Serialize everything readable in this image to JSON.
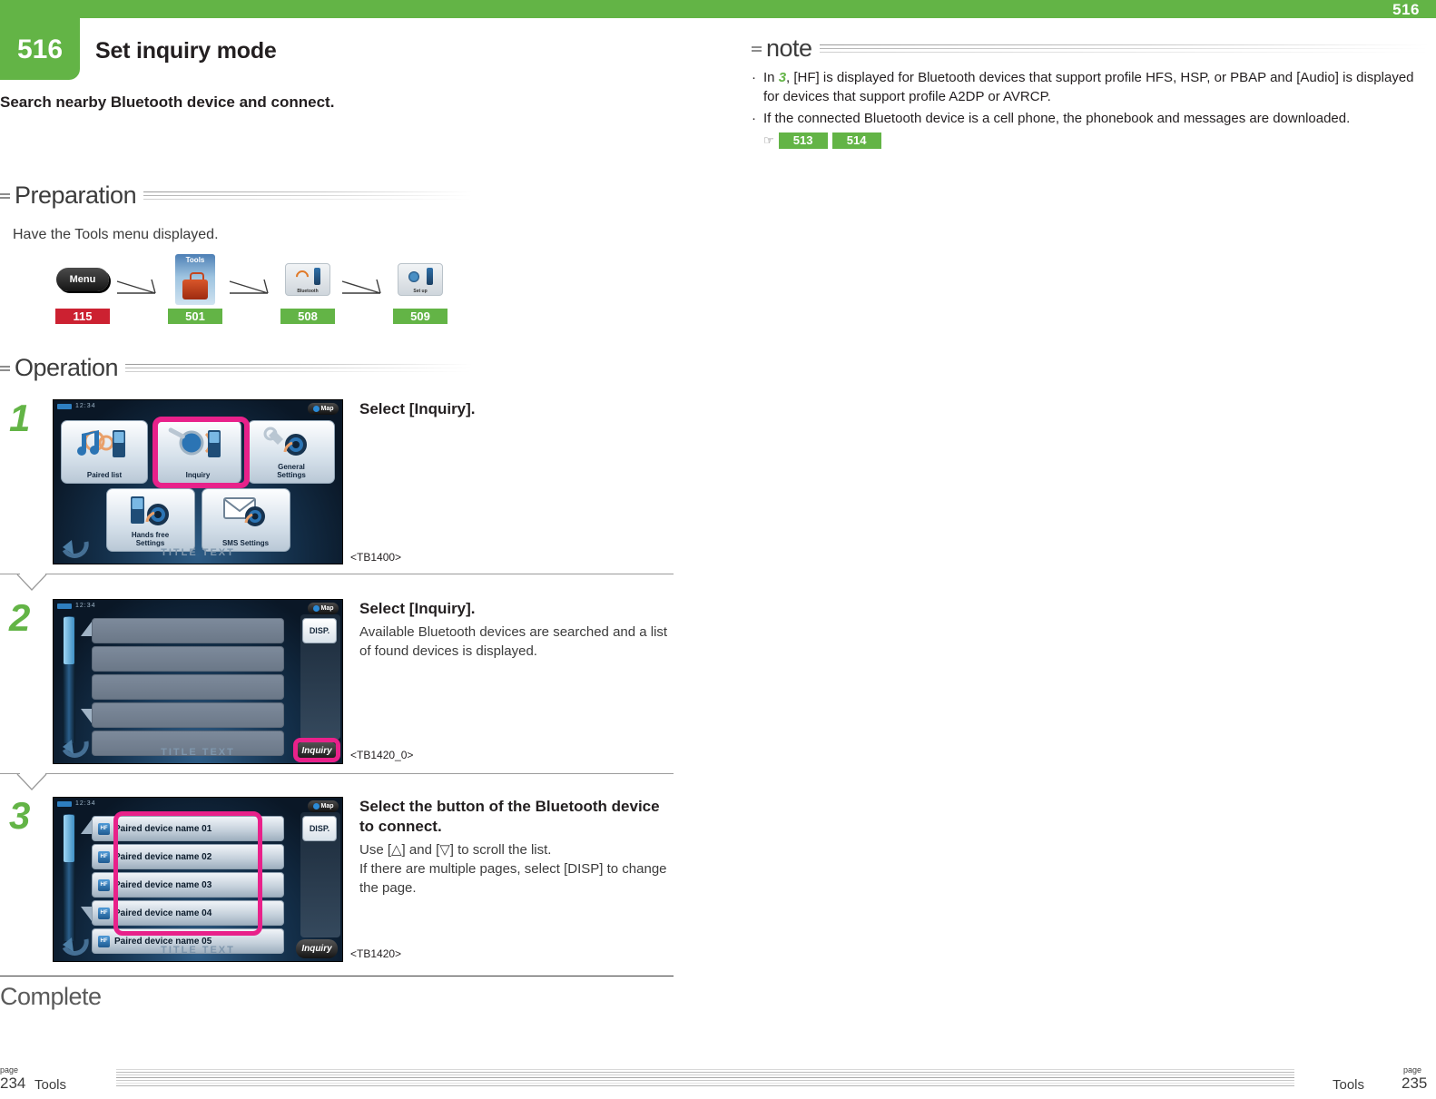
{
  "header": {
    "top_page_number": "516",
    "chapter_number": "516",
    "title": "Set inquiry mode",
    "lead": "Search nearby Bluetooth device and connect.",
    "accent_green": "#63b446",
    "accent_red": "#cc2131",
    "highlight_magenta": "#e8218a"
  },
  "preparation": {
    "heading": "Preparation",
    "text": "Have the Tools menu displayed.",
    "flow": [
      {
        "icon": "menu-icon",
        "icon_label": "Menu",
        "badge": "115",
        "badge_color": "#cc2131"
      },
      {
        "icon": "tools-icon",
        "icon_label": "Tools",
        "badge": "501",
        "badge_color": "#63b446"
      },
      {
        "icon": "bluetooth-icon",
        "icon_label": "Bluetooth",
        "badge": "508",
        "badge_color": "#63b446"
      },
      {
        "icon": "setup-icon",
        "icon_label": "Set up",
        "badge": "509",
        "badge_color": "#63b446"
      }
    ]
  },
  "operation": {
    "heading": "Operation",
    "steps": [
      {
        "number": "1",
        "title": "Select [Inquiry].",
        "desc": "",
        "code": "<TB1400>",
        "screen": {
          "clock": "12:34",
          "map_button": "Map",
          "title_text": "TITLE TEXT",
          "buttons": [
            {
              "label": "Paired list",
              "icon": "music-phone-icon",
              "highlighted": false
            },
            {
              "label": "Inquiry",
              "icon": "magnifier-phone-icon",
              "highlighted": true
            },
            {
              "label": "General\nSettings",
              "icon": "wrench-gear-icon",
              "highlighted": false
            },
            {
              "label": "Hands free\nSettings",
              "icon": "phone-gear-icon",
              "highlighted": false
            },
            {
              "label": "SMS Settings",
              "icon": "envelope-gear-icon",
              "highlighted": false
            }
          ]
        }
      },
      {
        "number": "2",
        "title": "Select [Inquiry].",
        "desc": "Available Bluetooth devices are searched and a list of found devices is displayed.",
        "code": "<TB1420_0>",
        "screen": {
          "clock": "12:34",
          "map_button": "Map",
          "title_text": "TITLE TEXT",
          "disp_button": "DISP.",
          "inquiry_button": "Inquiry",
          "inquiry_highlighted": true,
          "rows": [
            "",
            "",
            "",
            "",
            ""
          ]
        }
      },
      {
        "number": "3",
        "title": "Select the button of the Bluetooth device to connect.",
        "desc": "Use [△] and [▽] to scroll the list.\nIf there are multiple pages, select [DISP] to change the page.",
        "code": "<TB1420>",
        "screen": {
          "clock": "12:34",
          "map_button": "Map",
          "title_text": "TITLE TEXT",
          "disp_button": "DISP.",
          "inquiry_button": "Inquiry",
          "inquiry_highlighted": false,
          "list_highlighted": true,
          "rows": [
            {
              "tag": "HF",
              "name": "Paired device name 01"
            },
            {
              "tag": "HF",
              "name": "Paired device name 02"
            },
            {
              "tag": "HF",
              "name": "Paired device name 03"
            },
            {
              "tag": "HF",
              "name": "Paired device name 04"
            },
            {
              "tag": "HF",
              "name": "Paired device name 05"
            }
          ]
        }
      }
    ],
    "complete_label": "Complete"
  },
  "note": {
    "heading": "note",
    "items": [
      {
        "pre": "In ",
        "step_ref": "3",
        "post": ", [HF] is displayed for Bluetooth devices that support profile HFS, HSP, or PBAP and [Audio] is displayed for devices that support profile A2DP or AVRCP."
      },
      {
        "pre": "",
        "step_ref": "",
        "post": "If the connected Bluetooth device is a cell phone, the phonebook and messages are downloaded."
      }
    ],
    "references": [
      "513",
      "514"
    ]
  },
  "footer": {
    "left_page_label": "page",
    "left_page_number": "234",
    "left_chapter": "Tools",
    "right_page_label": "page",
    "right_page_number": "235",
    "right_chapter": "Tools"
  }
}
